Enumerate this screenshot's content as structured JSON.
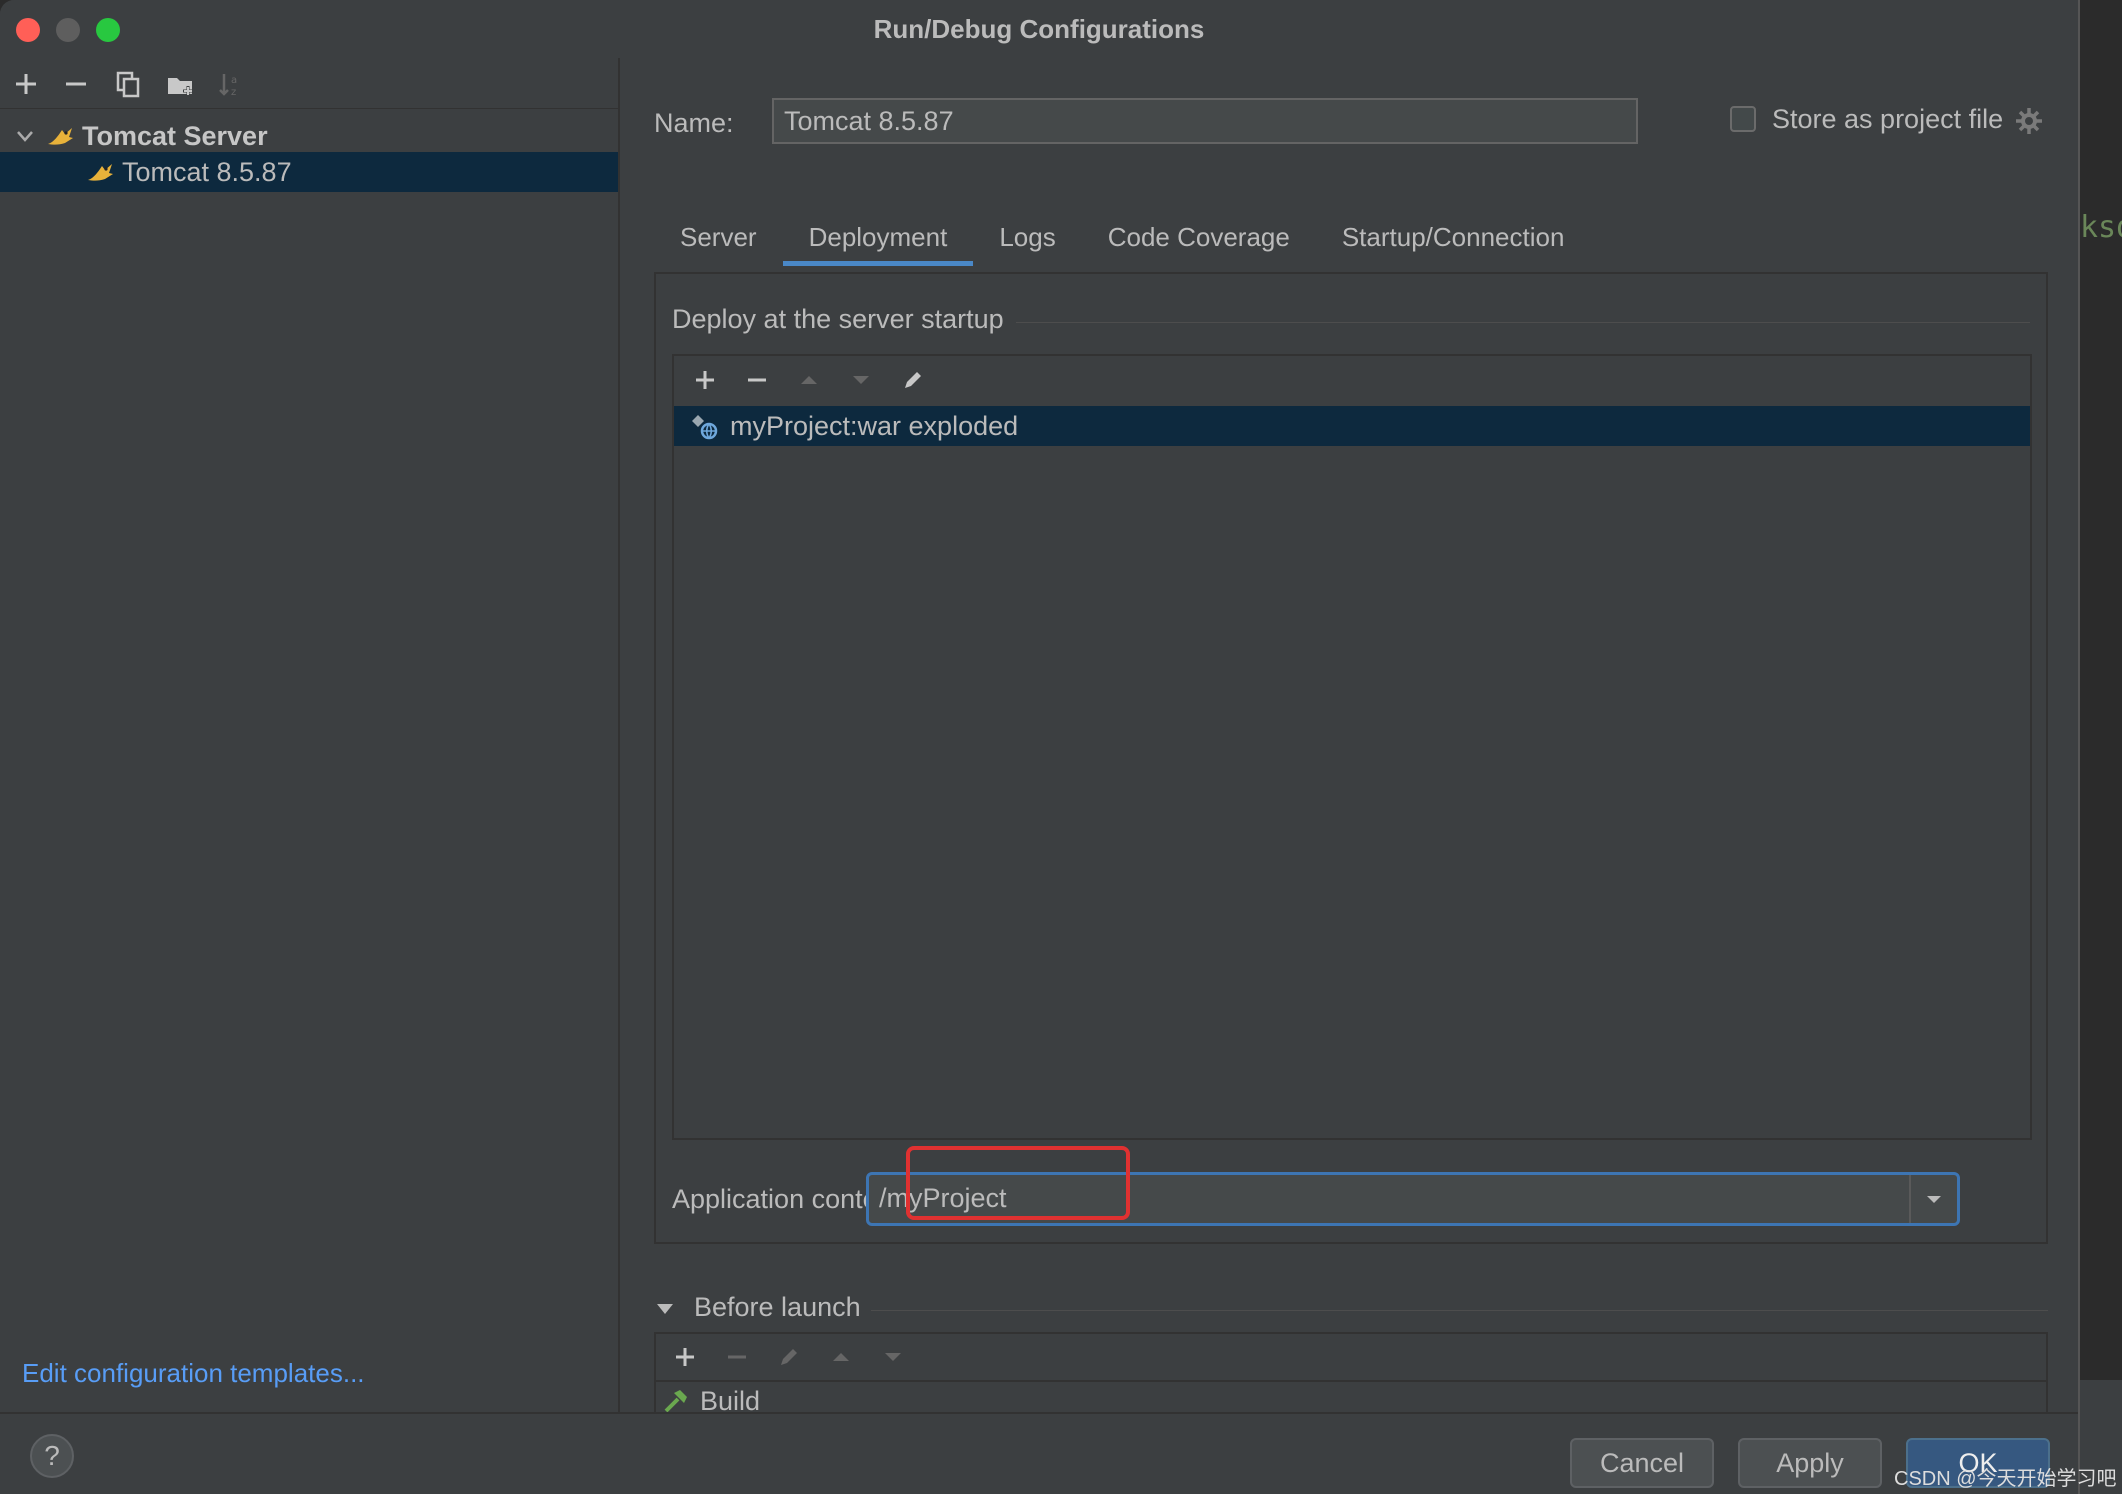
{
  "window": {
    "title": "Run/Debug Configurations"
  },
  "colors": {
    "accent": "#4a88c7",
    "selection": "#0d293e",
    "link": "#589df6",
    "highlight": "#e03131"
  },
  "left_panel": {
    "toolbar": [
      "add-icon",
      "remove-icon",
      "copy-icon",
      "folder-add-icon",
      "sort-icon"
    ],
    "tree": {
      "group": "Tomcat Server",
      "item": "Tomcat 8.5.87"
    },
    "edit_templates_link": "Edit configuration templates..."
  },
  "form": {
    "name_label": "Name:",
    "name_value": "Tomcat 8.5.87",
    "store_label": "Store as project file"
  },
  "tabs": [
    "Server",
    "Deployment",
    "Logs",
    "Code Coverage",
    "Startup/Connection"
  ],
  "active_tab": "Deployment",
  "deployment": {
    "section_title": "Deploy at the server startup",
    "artifacts": [
      "myProject:war exploded"
    ],
    "context_label": "Application context:",
    "context_value": "/myProject"
  },
  "before_launch": {
    "title": "Before launch",
    "tasks": [
      "Build"
    ]
  },
  "buttons": {
    "help": "?",
    "cancel": "Cancel",
    "apply": "Apply",
    "ok": "OK"
  },
  "background": {
    "code_fragment": "ksd"
  },
  "watermark": "CSDN @今天开始学习吧"
}
